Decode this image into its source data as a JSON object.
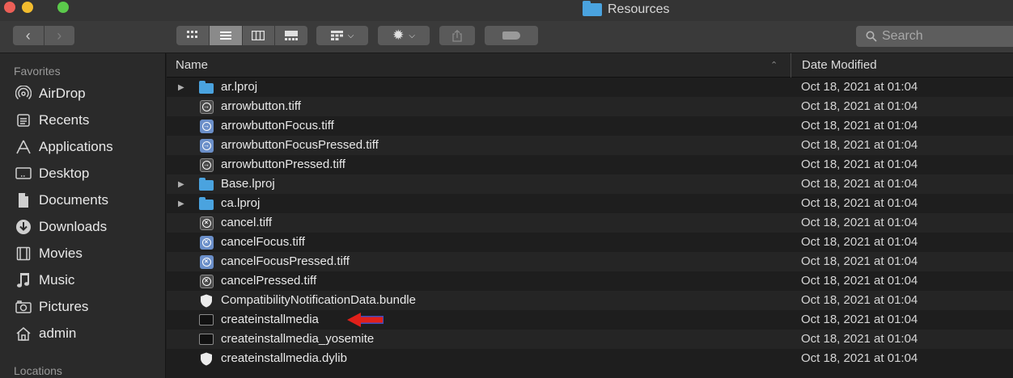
{
  "window": {
    "title": "Resources"
  },
  "toolbar": {
    "back_icon": "chevron-left-icon",
    "forward_icon": "chevron-right-icon",
    "view_modes": [
      "icon-view-icon",
      "list-view-icon",
      "column-view-icon",
      "gallery-view-icon"
    ],
    "active_view": "list",
    "group_icon": "group-icon",
    "action_icon": "gear-icon",
    "share_icon": "share-icon",
    "tag_icon": "tag-icon",
    "search_placeholder": "Search"
  },
  "sidebar": {
    "favorites_header": "Favorites",
    "items": [
      {
        "label": "AirDrop",
        "icon": "airdrop-icon"
      },
      {
        "label": "Recents",
        "icon": "recents-icon"
      },
      {
        "label": "Applications",
        "icon": "applications-icon"
      },
      {
        "label": "Desktop",
        "icon": "desktop-icon"
      },
      {
        "label": "Documents",
        "icon": "documents-icon"
      },
      {
        "label": "Downloads",
        "icon": "downloads-icon"
      },
      {
        "label": "Movies",
        "icon": "movies-icon"
      },
      {
        "label": "Music",
        "icon": "music-icon"
      },
      {
        "label": "Pictures",
        "icon": "pictures-icon"
      },
      {
        "label": "admin",
        "icon": "home-icon"
      }
    ],
    "locations_header": "Locations"
  },
  "columns": {
    "name": "Name",
    "date_modified": "Date Modified"
  },
  "files": [
    {
      "name": "ar.lproj",
      "date": "Oct 18, 2021 at 01:04",
      "kind": "folder"
    },
    {
      "name": "arrowbutton.tiff",
      "date": "Oct 18, 2021 at 01:04",
      "kind": "tiff-arrow"
    },
    {
      "name": "arrowbuttonFocus.tiff",
      "date": "Oct 18, 2021 at 01:04",
      "kind": "tiff-arrow"
    },
    {
      "name": "arrowbuttonFocusPressed.tiff",
      "date": "Oct 18, 2021 at 01:04",
      "kind": "tiff-arrow"
    },
    {
      "name": "arrowbuttonPressed.tiff",
      "date": "Oct 18, 2021 at 01:04",
      "kind": "tiff-arrow"
    },
    {
      "name": "Base.lproj",
      "date": "Oct 18, 2021 at 01:04",
      "kind": "folder"
    },
    {
      "name": "ca.lproj",
      "date": "Oct 18, 2021 at 01:04",
      "kind": "folder"
    },
    {
      "name": "cancel.tiff",
      "date": "Oct 18, 2021 at 01:04",
      "kind": "tiff-cancel"
    },
    {
      "name": "cancelFocus.tiff",
      "date": "Oct 18, 2021 at 01:04",
      "kind": "tiff-cancel"
    },
    {
      "name": "cancelFocusPressed.tiff",
      "date": "Oct 18, 2021 at 01:04",
      "kind": "tiff-cancel"
    },
    {
      "name": "cancelPressed.tiff",
      "date": "Oct 18, 2021 at 01:04",
      "kind": "tiff-cancel"
    },
    {
      "name": "CompatibilityNotificationData.bundle",
      "date": "Oct 18, 2021 at 01:04",
      "kind": "bundle"
    },
    {
      "name": "createinstallmedia",
      "date": "Oct 18, 2021 at 01:04",
      "kind": "exec"
    },
    {
      "name": "createinstallmedia_yosemite",
      "date": "Oct 18, 2021 at 01:04",
      "kind": "exec"
    },
    {
      "name": "createinstallmedia.dylib",
      "date": "Oct 18, 2021 at 01:04",
      "kind": "bundle"
    }
  ],
  "annotation": {
    "target_file": "createinstallmedia",
    "arrow_color": "#e0201a"
  },
  "colors": {
    "folder": "#4aa3df",
    "tiff": "#6b8fc9",
    "window_bg": "#1e1e1e",
    "sidebar_bg": "#2a2a2a"
  }
}
